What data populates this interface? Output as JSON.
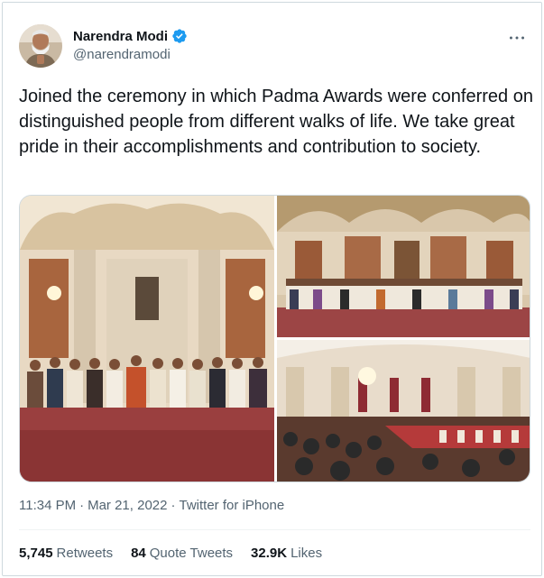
{
  "author": {
    "display_name": "Narendra Modi",
    "handle": "@narendramodi",
    "verified": true,
    "verified_color": "#1d9bf0"
  },
  "tweet": {
    "text": "Joined the ceremony in which Padma Awards were conferred on distinguished people from different walks of life. We take great pride in their accomplishments and contribution to society."
  },
  "meta": {
    "time": "11:34 PM",
    "separator": "·",
    "date": "Mar 21, 2022",
    "source": "Twitter for iPhone"
  },
  "stats": {
    "retweets_count": "5,745",
    "retweets_label": "Retweets",
    "quotes_count": "84",
    "quotes_label": "Quote Tweets",
    "likes_count": "32.9K",
    "likes_label": "Likes"
  },
  "icons": {
    "more": "more-horizontal-icon",
    "verified": "verified-badge-icon"
  },
  "colors": {
    "text_primary": "#0f1419",
    "text_secondary": "#536471",
    "border": "#cfd9de"
  }
}
